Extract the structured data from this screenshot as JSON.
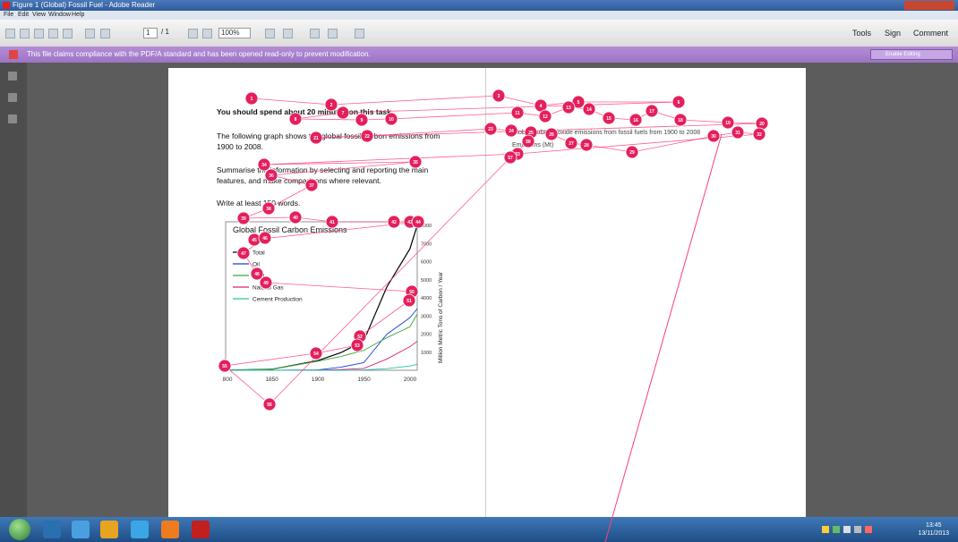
{
  "window": {
    "title": "Figure 1 (Global) Fossil Fuel - Adobe Reader",
    "menu": [
      "File",
      "Edit",
      "View",
      "Window",
      "Help"
    ]
  },
  "toolbar": {
    "page_current": "1",
    "page_total": "/ 1",
    "zoom": "100%",
    "tools_label": "Tools",
    "sign_label": "Sign",
    "comment_label": "Comment"
  },
  "notification": {
    "text": "This file claims compliance with the PDF/A standard and has been opened read-only to prevent modification.",
    "button_label": "Enable Editing"
  },
  "document": {
    "heading": "You should spend about 20 minutes on this task.",
    "para1": "The following graph shows the global fossil carbon emissions from 1900 to 2008.",
    "para2": "Summarise the information by selecting and reporting the main features, and make comparisons where relevant.",
    "word_limit": "Write at least 150 words.",
    "right_snippet1": "Global carbon dioxide emissions from fossil fuels from 1900 to 2008",
    "right_snippet2": "Emissions (Mt)"
  },
  "chart_data": {
    "type": "line",
    "title": "Global Fossil Carbon Emissions",
    "xlabel": "",
    "ylabel": "Million Metric Tons of Carbon / Year",
    "x": [
      1800,
      1850,
      1900,
      1925,
      1950,
      1975,
      2000,
      2008
    ],
    "xticks": [
      "1800",
      "1850",
      "1900",
      "1950",
      "2000"
    ],
    "ylim": [
      0,
      8000
    ],
    "yticks": [
      "1000",
      "2000",
      "3000",
      "4000",
      "5000",
      "6000",
      "7000",
      "8000"
    ],
    "series": [
      {
        "name": "Total",
        "color": "#000000",
        "values": [
          8,
          54,
          534,
          970,
          1630,
          4600,
          6700,
          8000
        ]
      },
      {
        "name": "Oil",
        "color": "#1a3fd8",
        "values": [
          0,
          0,
          20,
          170,
          420,
          1990,
          2900,
          3400
        ]
      },
      {
        "name": "Coal",
        "color": "#3ba63b",
        "values": [
          8,
          54,
          500,
          760,
          1100,
          1800,
          2400,
          3100
        ]
      },
      {
        "name": "Natural Gas",
        "color": "#d8246a",
        "values": [
          0,
          0,
          10,
          40,
          100,
          620,
          1300,
          1600
        ]
      },
      {
        "name": "Cement Production",
        "color": "#22c4a8",
        "values": [
          0,
          0,
          2,
          5,
          20,
          90,
          240,
          330
        ]
      }
    ],
    "legend_placement": "top-left",
    "grid": false
  },
  "taskbar": {
    "clock_time": "13:45",
    "clock_date": "13/11/2013"
  }
}
